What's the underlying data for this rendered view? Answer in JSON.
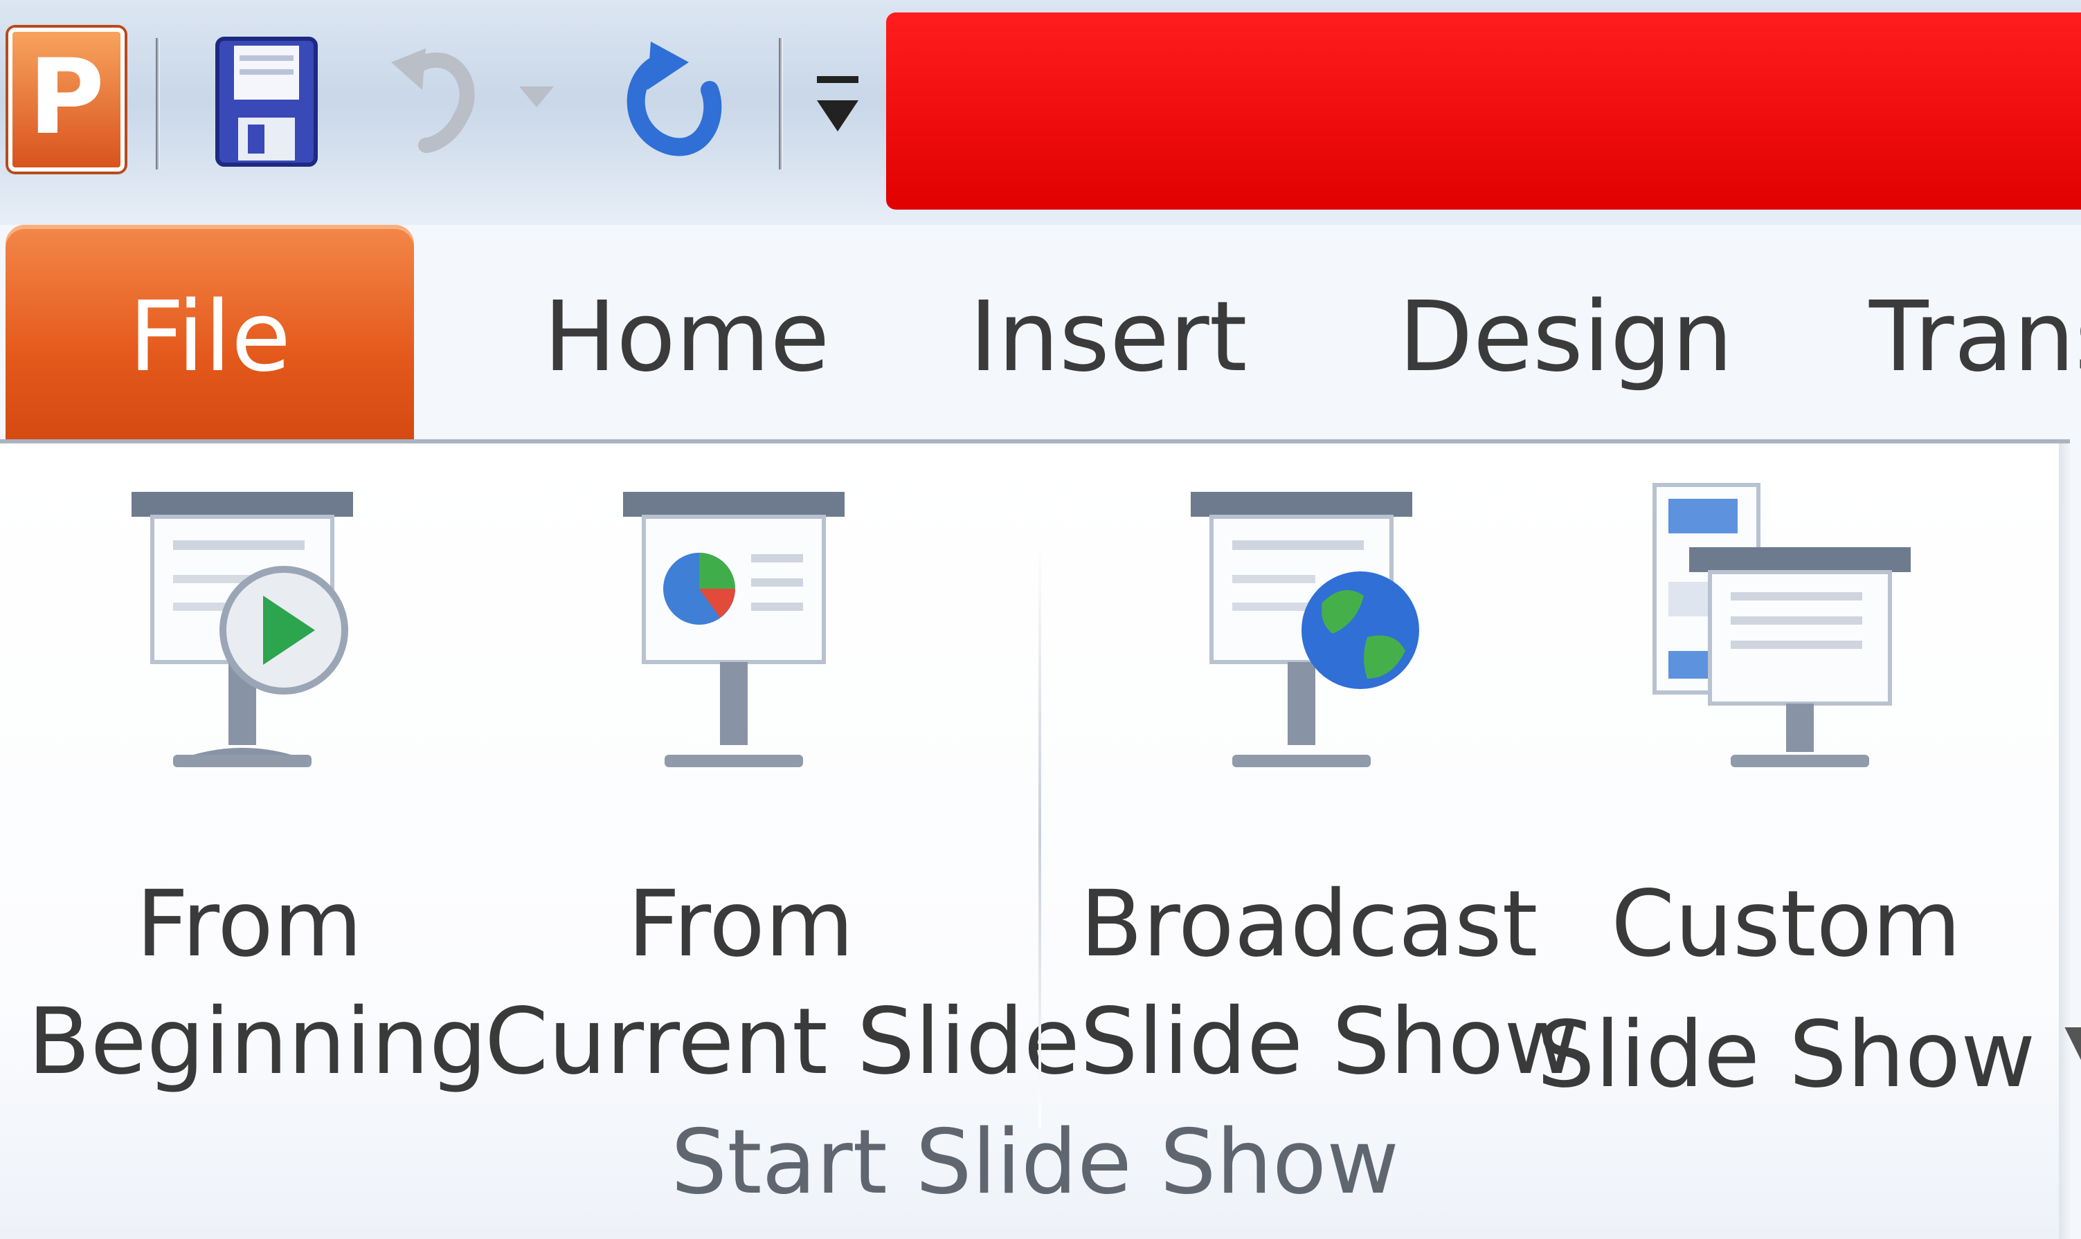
{
  "app": {
    "icon_letter": "P",
    "icon": "powerpoint-icon"
  },
  "quick_access": {
    "items": [
      "save-icon",
      "undo-icon",
      "redo-icon",
      "customize-quick-access-icon"
    ]
  },
  "tabs": {
    "file": "File",
    "home": "Home",
    "insert": "Insert",
    "design": "Design",
    "transitions": "Trans"
  },
  "ribbon": {
    "group_label": "Start Slide Show",
    "buttons": {
      "from_beginning": {
        "line1": "From",
        "line2": "Beginning",
        "icon": "play-screen-icon"
      },
      "from_current": {
        "line1": "From",
        "line2": "Current Slide",
        "icon": "pie-screen-icon"
      },
      "broadcast": {
        "line1": "Broadcast",
        "line2": "Slide Show",
        "icon": "globe-screen-icon"
      },
      "custom": {
        "line1": "Custom",
        "line2": "Slide Show",
        "icon": "custom-show-icon"
      }
    }
  },
  "colors": {
    "file_tab": "#e45a1c",
    "title_area": "#ff0000",
    "accent_blue": "#2f6fd6"
  }
}
